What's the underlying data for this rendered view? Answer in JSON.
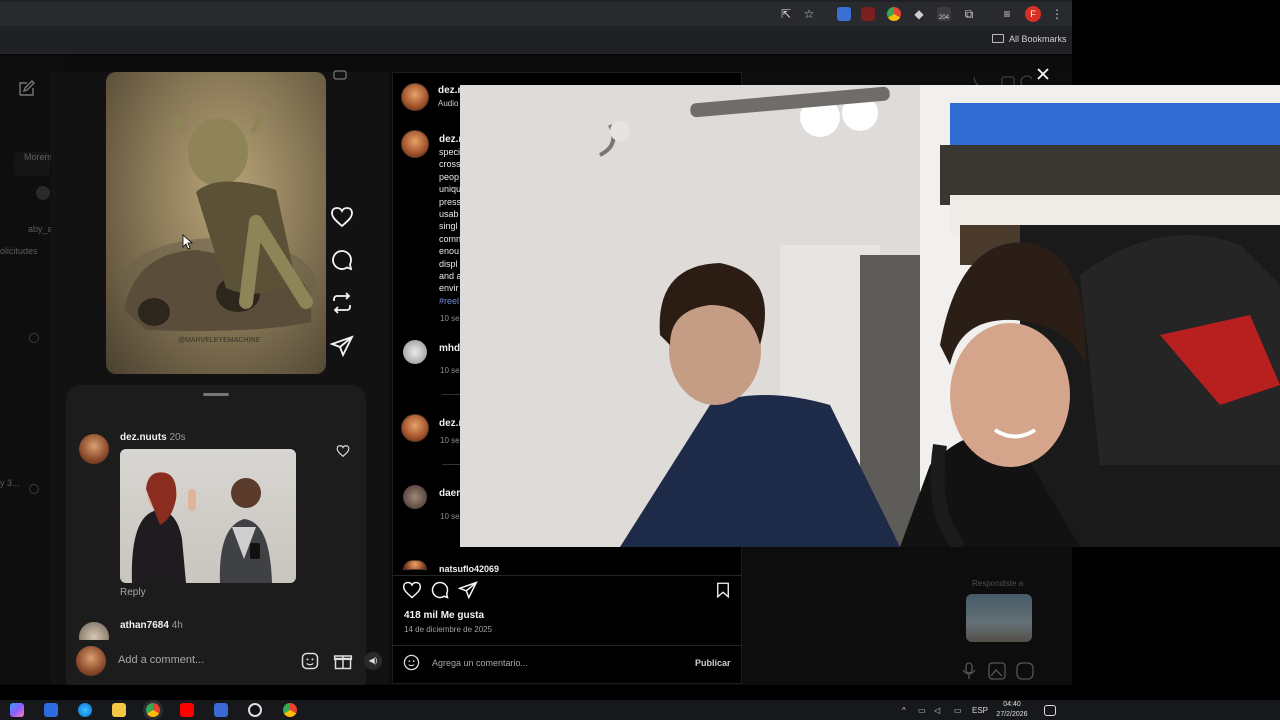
{
  "browser": {
    "bookmarks_label": "All Bookmarks",
    "extension_badge": "204",
    "profile_initial": "F"
  },
  "sidebar": {
    "partial_labels": [
      "Morem",
      "aby_a",
      "olicitudes",
      "y 3..."
    ]
  },
  "reel": {
    "watermark": "@MARVELEYEMACHINE",
    "comments": [
      {
        "username": "dez.nuuts",
        "time": "20s",
        "reply_label": "Reply"
      },
      {
        "username": "athan7684",
        "time": "4h"
      }
    ],
    "add_comment_placeholder": "Add a comment..."
  },
  "post": {
    "header_user": "dez.n",
    "header_sub": "Audio",
    "caption_user": "dez.n",
    "caption_lines": [
      "speci",
      "cross",
      "peop",
      "uniqu",
      "press",
      "usab",
      "singl",
      "comn",
      "enou",
      "displ",
      "and a",
      "envir"
    ],
    "hashtag": "#reel",
    "caption_time": "10 se",
    "comments": [
      {
        "username": "mhd",
        "time": "10 se"
      },
      {
        "username": "dez.n",
        "time": "10 se"
      },
      {
        "username": "daer",
        "time": "10 se"
      },
      {
        "username": "natsuflo42069"
      }
    ],
    "likes": "418 mil Me gusta",
    "date": "14 de diciembre de 2025",
    "comment_placeholder": "Agrega un comentario...",
    "publish_label": "Publicar",
    "right_reply_hint": "Respondiste a"
  },
  "taskbar": {
    "lang": "ESP",
    "time": "04:40",
    "date": "27/2/2026"
  },
  "colors": {
    "ig_bg": "#000000",
    "panel": "#1c1c1c",
    "brand_red": "#d93025"
  }
}
